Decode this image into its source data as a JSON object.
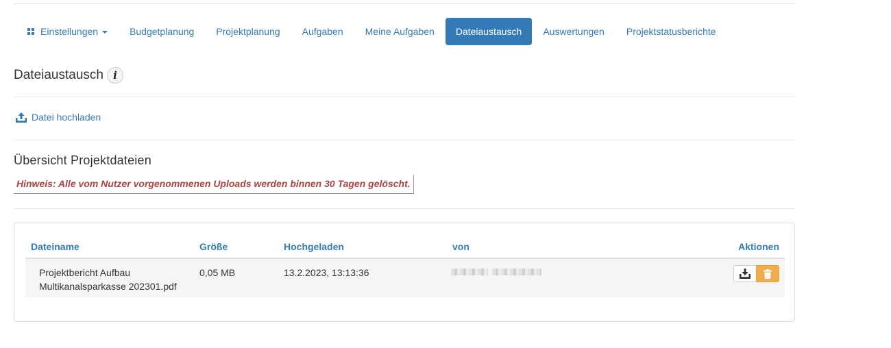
{
  "nav": {
    "settings_label": "Einstellungen",
    "items": [
      {
        "label": "Budgetplanung"
      },
      {
        "label": "Projektplanung"
      },
      {
        "label": "Aufgaben"
      },
      {
        "label": "Meine Aufgaben"
      },
      {
        "label": "Dateiaustausch",
        "active": true
      },
      {
        "label": "Auswertungen"
      },
      {
        "label": "Projektstatusberichte"
      }
    ]
  },
  "page": {
    "title": "Dateiaustausch",
    "info_icon": "i",
    "upload_label": "Datei hochladen",
    "overview_title": "Übersicht Projektdateien",
    "notice": "Hinweis: Alle vom Nutzer vorgenommenen Uploads werden binnen 30 Tagen gelöscht."
  },
  "table": {
    "columns": [
      "Dateiname",
      "Größe",
      "Hochgeladen",
      "von",
      "Aktionen"
    ],
    "rows": [
      {
        "filename_line1": "Projektbericht Aufbau",
        "filename_line2": "Multikanalsparkasse 202301.pdf",
        "size": "0,05 MB",
        "uploaded": "13.2.2023, 13:13:36",
        "by": "[redacted]"
      }
    ]
  },
  "colors": {
    "link": "#337ab7",
    "active_tab_bg": "#337ab7",
    "notice_text": "#a94442",
    "delete_button": "#f0ad4e"
  },
  "icons": {
    "settings": "grid-icon",
    "dropdown": "caret-down-icon",
    "info": "info-icon",
    "upload": "upload-icon",
    "download": "download-icon",
    "delete": "trash-icon"
  }
}
